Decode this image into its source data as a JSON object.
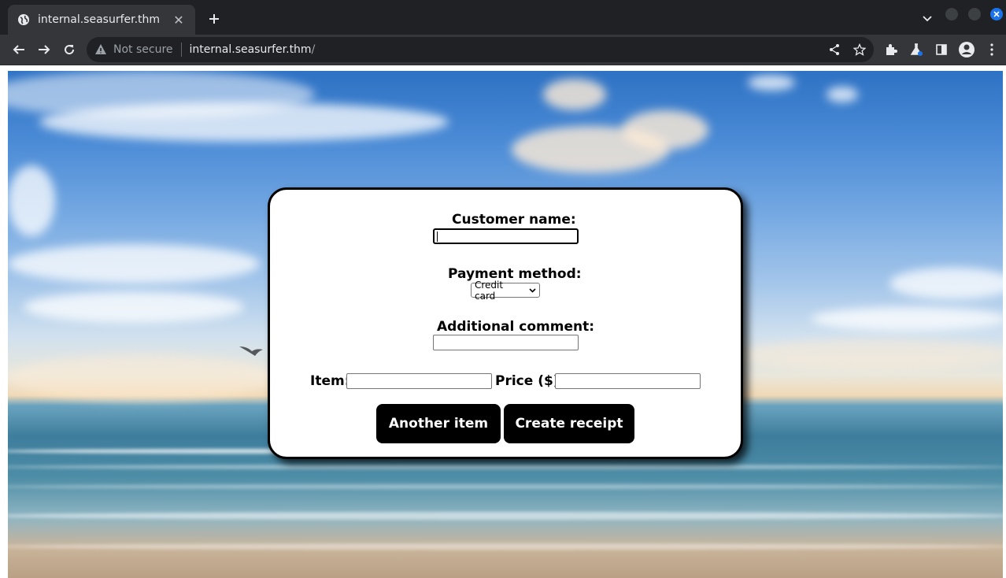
{
  "browser": {
    "tab_title": "internal.seasurfer.thm",
    "security_label": "Not secure",
    "url_host": "internal.seasurfer.thm",
    "url_path": "/"
  },
  "form": {
    "customer_name_label": "Customer name:",
    "customer_name_value": "",
    "payment_method_label": "Payment method:",
    "payment_method_selected": "Credit card",
    "additional_comment_label": "Additional comment:",
    "additional_comment_value": "",
    "item_label": "Item:",
    "item_value": "",
    "price_label": "Price ($):",
    "price_value": "",
    "another_item_button": "Another item",
    "create_receipt_button": "Create receipt"
  },
  "colors": {
    "chrome_dark": "#202124",
    "chrome_toolbar": "#35363a",
    "button_bg": "#000000",
    "button_text": "#ffffff",
    "close_window_accent": "#1a73e8"
  },
  "icons": [
    "globe-icon",
    "close-icon",
    "plus-icon",
    "chevron-down-icon",
    "back-arrow-icon",
    "forward-arrow-icon",
    "reload-icon",
    "warning-icon",
    "share-icon",
    "star-icon",
    "extensions-icon",
    "labs-icon",
    "side-panel-icon",
    "profile-icon",
    "more-vert-icon"
  ]
}
